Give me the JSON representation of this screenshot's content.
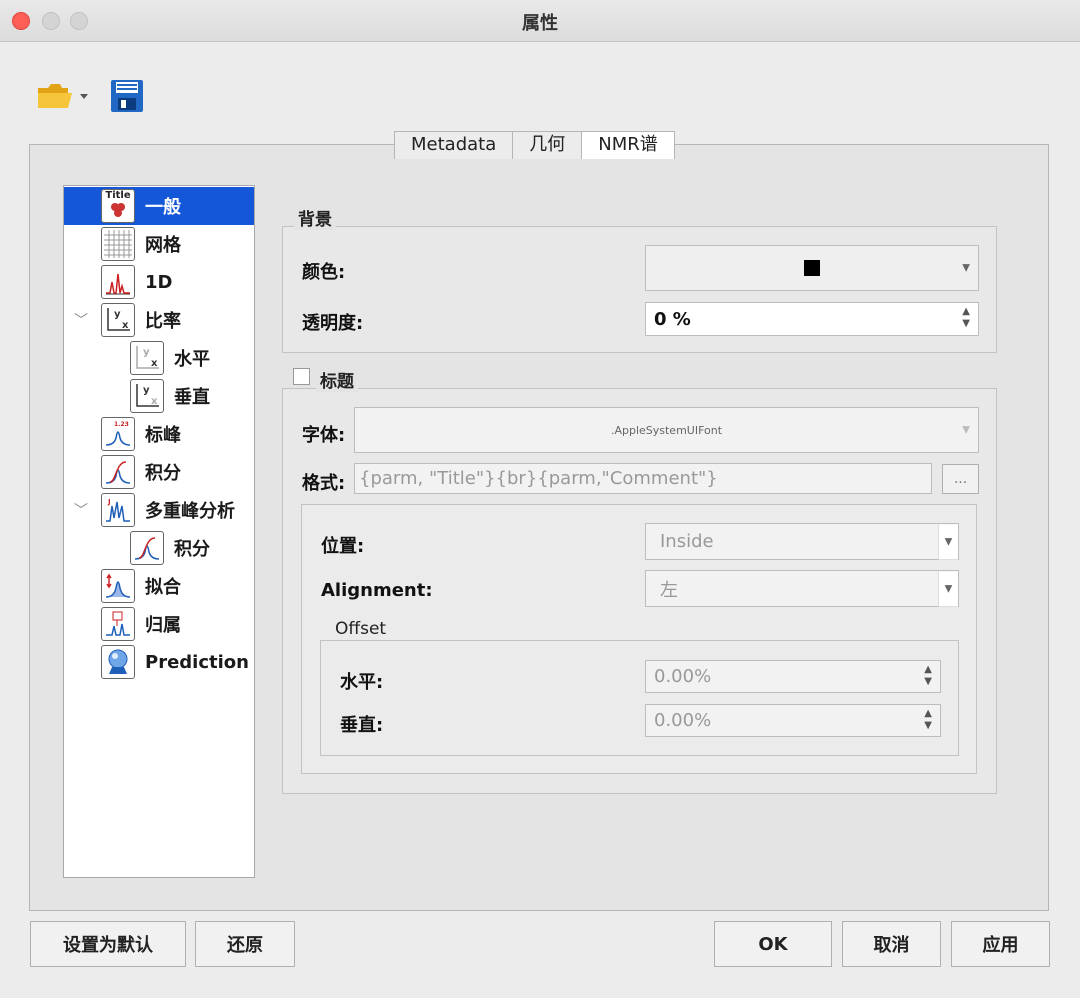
{
  "window": {
    "title": "属性"
  },
  "tabs": [
    {
      "label": "Metadata"
    },
    {
      "label": "几何"
    },
    {
      "label": "NMR谱"
    }
  ],
  "tree": {
    "items": [
      {
        "label": "一般",
        "icon": "title-icon",
        "icon_text": "Title",
        "selected": true
      },
      {
        "label": "网格",
        "icon": "grid-icon"
      },
      {
        "label": "1D",
        "icon": "spectrum-1d-icon"
      },
      {
        "label": "比率",
        "icon": "ratio-icon"
      },
      {
        "label": "水平",
        "icon": "ratio-horizontal-icon"
      },
      {
        "label": "垂直",
        "icon": "ratio-vertical-icon"
      },
      {
        "label": "标峰",
        "icon": "peak-label-icon"
      },
      {
        "label": "积分",
        "icon": "integral-icon"
      },
      {
        "label": "多重峰分析",
        "icon": "multiplet-icon"
      },
      {
        "label": "积分",
        "icon": "integral-icon"
      },
      {
        "label": "拟合",
        "icon": "fit-icon"
      },
      {
        "label": "归属",
        "icon": "assignment-icon"
      },
      {
        "label": "Prediction",
        "icon": "prediction-icon"
      }
    ]
  },
  "background": {
    "group_label": "背景",
    "color_label": "颜色:",
    "color_value": "#000000",
    "opacity_label": "透明度:",
    "opacity_value": "0 %"
  },
  "title_section": {
    "checkbox_label": "标题",
    "font_label": "字体:",
    "font_value": ".AppleSystemUIFont",
    "format_label": "格式:",
    "format_value": "{parm, \"Title\"}{br}{parm,\"Comment\"}",
    "browse_label": "...",
    "position_label": "位置:",
    "position_value": "Inside",
    "alignment_label": "Alignment:",
    "alignment_value": "左",
    "offset_label": "Offset",
    "horizontal_label": "水平:",
    "horizontal_value": "0.00%",
    "vertical_label": "垂直:",
    "vertical_value": "0.00%"
  },
  "buttons": {
    "set_default": "设置为默认",
    "restore": "还原",
    "ok": "OK",
    "cancel": "取消",
    "apply": "应用"
  }
}
